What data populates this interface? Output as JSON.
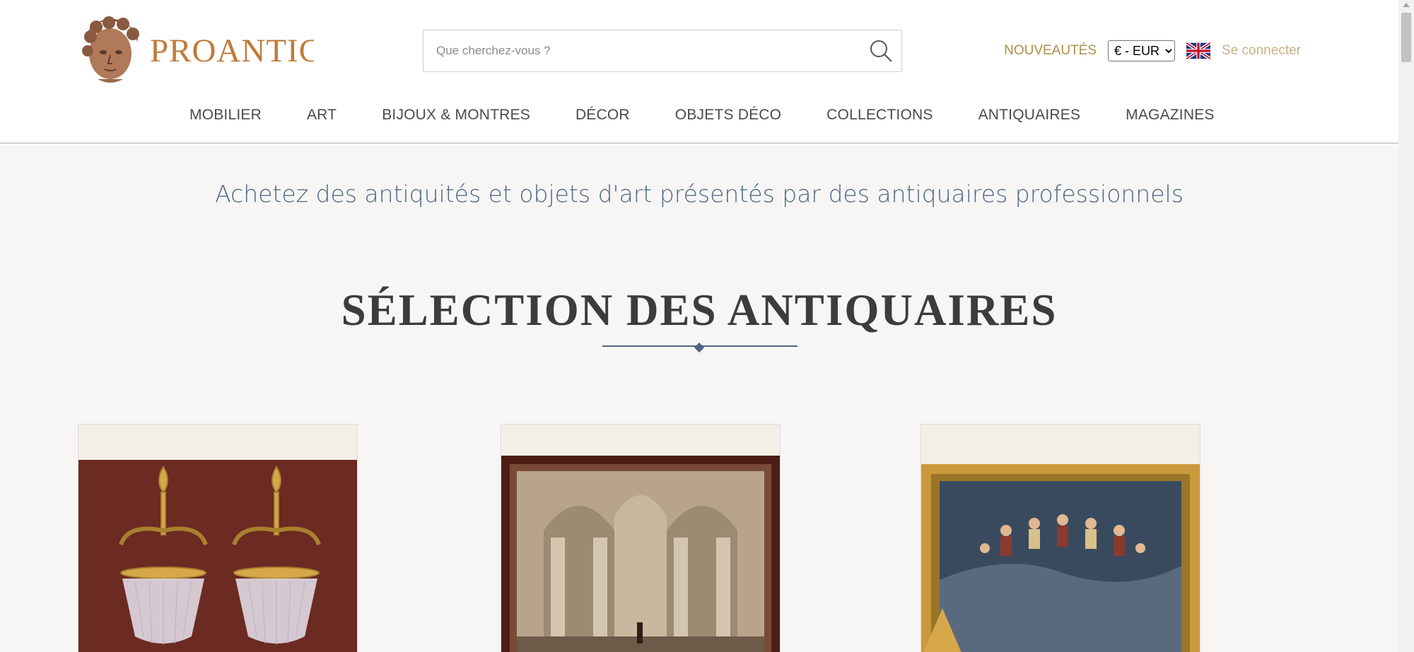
{
  "brand": {
    "name": "PROANTIC"
  },
  "search": {
    "placeholder": "Que cherchez-vous ?"
  },
  "top_links": {
    "new": "NOUVEAUTÉS",
    "currency": "€ - EUR",
    "login": "Se connecter"
  },
  "nav": {
    "items": [
      {
        "label": "MOBILIER"
      },
      {
        "label": "ART"
      },
      {
        "label": "BIJOUX & MONTRES"
      },
      {
        "label": "DÉCOR"
      },
      {
        "label": "OBJETS DÉCO"
      },
      {
        "label": "COLLECTIONS"
      },
      {
        "label": "ANTIQUAIRES"
      },
      {
        "label": "MAGAZINES"
      }
    ]
  },
  "tagline": "Achetez des antiquités et objets d'art présentés par des antiquaires professionnels",
  "section": {
    "title": "SÉLECTION DES ANTIQUAIRES"
  },
  "products": [
    {
      "image": "pair-of-crystal-chandeliers"
    },
    {
      "image": "church-interior-painting"
    },
    {
      "image": "mythological-scene-painting"
    }
  ],
  "colors": {
    "brand": "#c07a3a",
    "accent": "#4d6683",
    "gold": "#b08d4a",
    "background": "#f7f6f5"
  },
  "icons": {
    "search": "magnifier-icon",
    "flag": "uk-flag-icon"
  }
}
